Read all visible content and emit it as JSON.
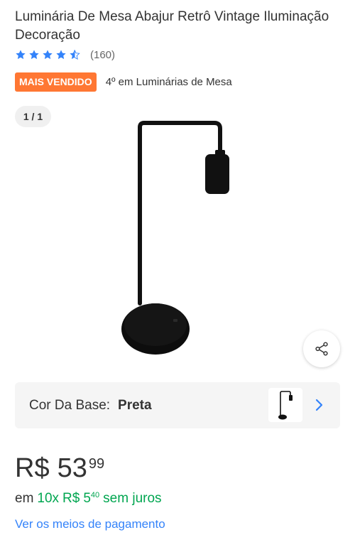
{
  "product": {
    "title": "Luminária De Mesa Abajur Retrô Vintage Iluminação Decoração",
    "rating": {
      "value": 4.5,
      "max": 5,
      "count_label": "(160)"
    },
    "badge": "MAIS VENDIDO",
    "rank": "4º em Luminárias de Mesa"
  },
  "gallery": {
    "counter": "1 / 1"
  },
  "variant": {
    "label": "Cor Da Base:",
    "value": "Preta"
  },
  "price": {
    "currency": "R$",
    "integer": "53",
    "cents": "99"
  },
  "installments": {
    "prefix": "em",
    "count": "10x",
    "currency": "R$",
    "integer": "5",
    "cents": "40",
    "suffix": "sem juros"
  },
  "links": {
    "payment_methods": "Ver os meios de pagamento"
  },
  "colors": {
    "accent": "#3483fa",
    "badge": "#ff7733",
    "success": "#00a650"
  }
}
